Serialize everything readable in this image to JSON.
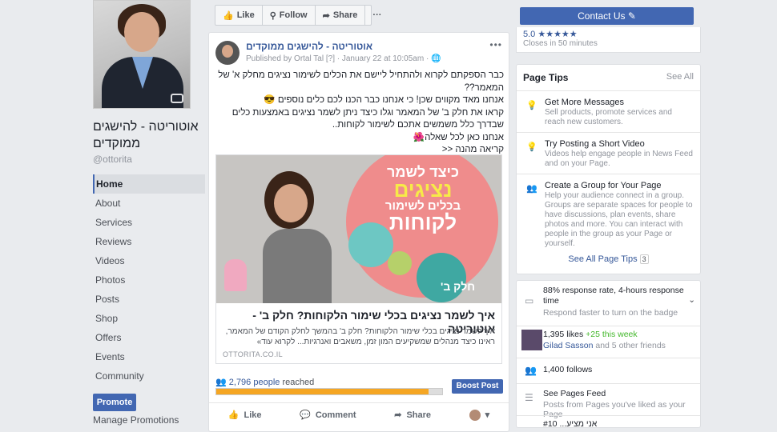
{
  "sidebar": {
    "page_name": "אוטוריטה - להישגים ממוקדים",
    "handle": "@ottorita",
    "nav": [
      "Home",
      "About",
      "Services",
      "Reviews",
      "Videos",
      "Photos",
      "Posts",
      "Shop",
      "Offers",
      "Events",
      "Community"
    ],
    "promote_label": "Promote",
    "manage_label": "Manage Promotions"
  },
  "actionbar": {
    "like": "Like",
    "follow": "Follow",
    "share": "Share",
    "more": "···"
  },
  "contact": {
    "label": "Contact Us ✎"
  },
  "rating": {
    "score": "5.0 ★★★★★",
    "closes": "Closes in 50 minutes"
  },
  "post": {
    "title": "אוטוריטה - להישגים ממוקדים",
    "meta": "Published by Ortal Tal [?] · January 22 at 10:05am · 🌐",
    "text_lines": [
      "כבר הספקתם לקרוא ולהתחיל ליישם את הכלים לשימור נציגים מחלק א' של המאמר??",
      "אנחנו מאד מקווים שכן! כי אנחנו כבר הכנו לכם כלים נוספים 😎",
      "קראו את חלק ב' של המאמר וגלו כיצד ניתן לשמר נציגים באמצעות כלים שבדרך כלל משמשים אתכם לשימור לקוחות..",
      "אנחנו כאן לכל שאלה🌺",
      "קריאה מהנה <<"
    ],
    "image_text": {
      "line1": "כיצד לשמר",
      "line2": "נציגים",
      "line3": "בכלים לשימור",
      "line4": "לקוחות",
      "part": "חלק ב'"
    },
    "link_headline": "איך לשמר נציגים בכלי שימור הלקוחות? חלק ב' - אוטוריטה",
    "link_desc": "איך לשמר נציגים בכלי שימור הלקוחות? חלק ב' בהמשך לחלק הקודם של המאמר, ראינו כיצד מנהלים שמשקיעים המון זמן, משאבים ואנרגיות... לקרוא עוד»",
    "link_domain": "OTTORITA.CO.IL",
    "reach_count": "2,796 people",
    "reach_suffix": "reached",
    "reach_fraction": 0.94,
    "boost_label": "Boost Post",
    "actions": {
      "like": "Like",
      "comment": "Comment",
      "share": "Share"
    }
  },
  "tips": {
    "title": "Page Tips",
    "see_all": "See All",
    "items": [
      {
        "title": "Get More Messages",
        "desc": "Sell products, promote services and reach new customers."
      },
      {
        "title": "Try Posting a Short Video",
        "desc": "Videos help engage people in News Feed and on your Page."
      },
      {
        "title": "Create a Group for Your Page",
        "desc": "Help your audience connect in a group. Groups are separate spaces for people to have discussions, plan events, share photos and more. You can interact with people in the group as your Page or yourself."
      }
    ],
    "see_tips": "See All Page Tips",
    "see_tips_count": "3"
  },
  "stats": {
    "response": "88% response rate, 4-hours response time",
    "response_sub": "Respond faster to turn on the badge",
    "likes": "1,395 likes",
    "likes_week": "+25 this week",
    "likes_friend": "Gilad Sasson",
    "likes_others": "and 5 other friends",
    "follows": "1,400 follows",
    "feed_title": "See Pages Feed",
    "feed_desc": "Posts from Pages you've liked as your Page",
    "cut_line": "אני מציע... #10"
  },
  "colors": {
    "brand": "#4267b2",
    "link": "#365899",
    "reach": "#f5a623"
  }
}
